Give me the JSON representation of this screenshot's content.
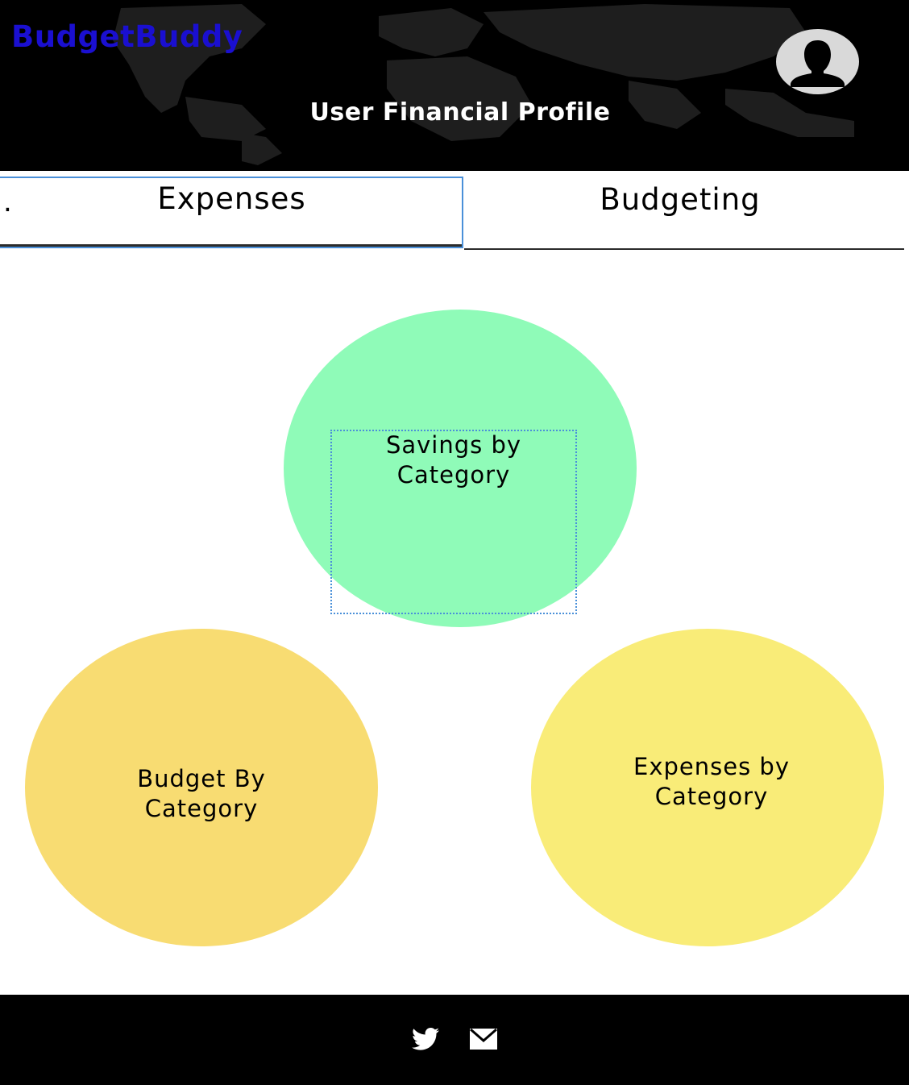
{
  "header": {
    "brand": "BudgetBuddy",
    "title": "User Financial Profile",
    "avatar_icon": "user-avatar-icon",
    "brand_color": "#1a0fd0"
  },
  "tabs": [
    {
      "label": "Expenses",
      "active": true,
      "marker": "."
    },
    {
      "label": "Budgeting",
      "active": false
    }
  ],
  "categories": {
    "savings": {
      "line1": "Savings by",
      "line2": "Category",
      "color": "#8ffbb8"
    },
    "budget": {
      "line1": "Budget By",
      "line2": "Category",
      "color": "#f8dc72"
    },
    "expenses": {
      "line1": "Expenses by",
      "line2": "Category",
      "color": "#f9ec78"
    }
  },
  "footer": {
    "icons": [
      "twitter-icon",
      "mail-icon"
    ]
  }
}
